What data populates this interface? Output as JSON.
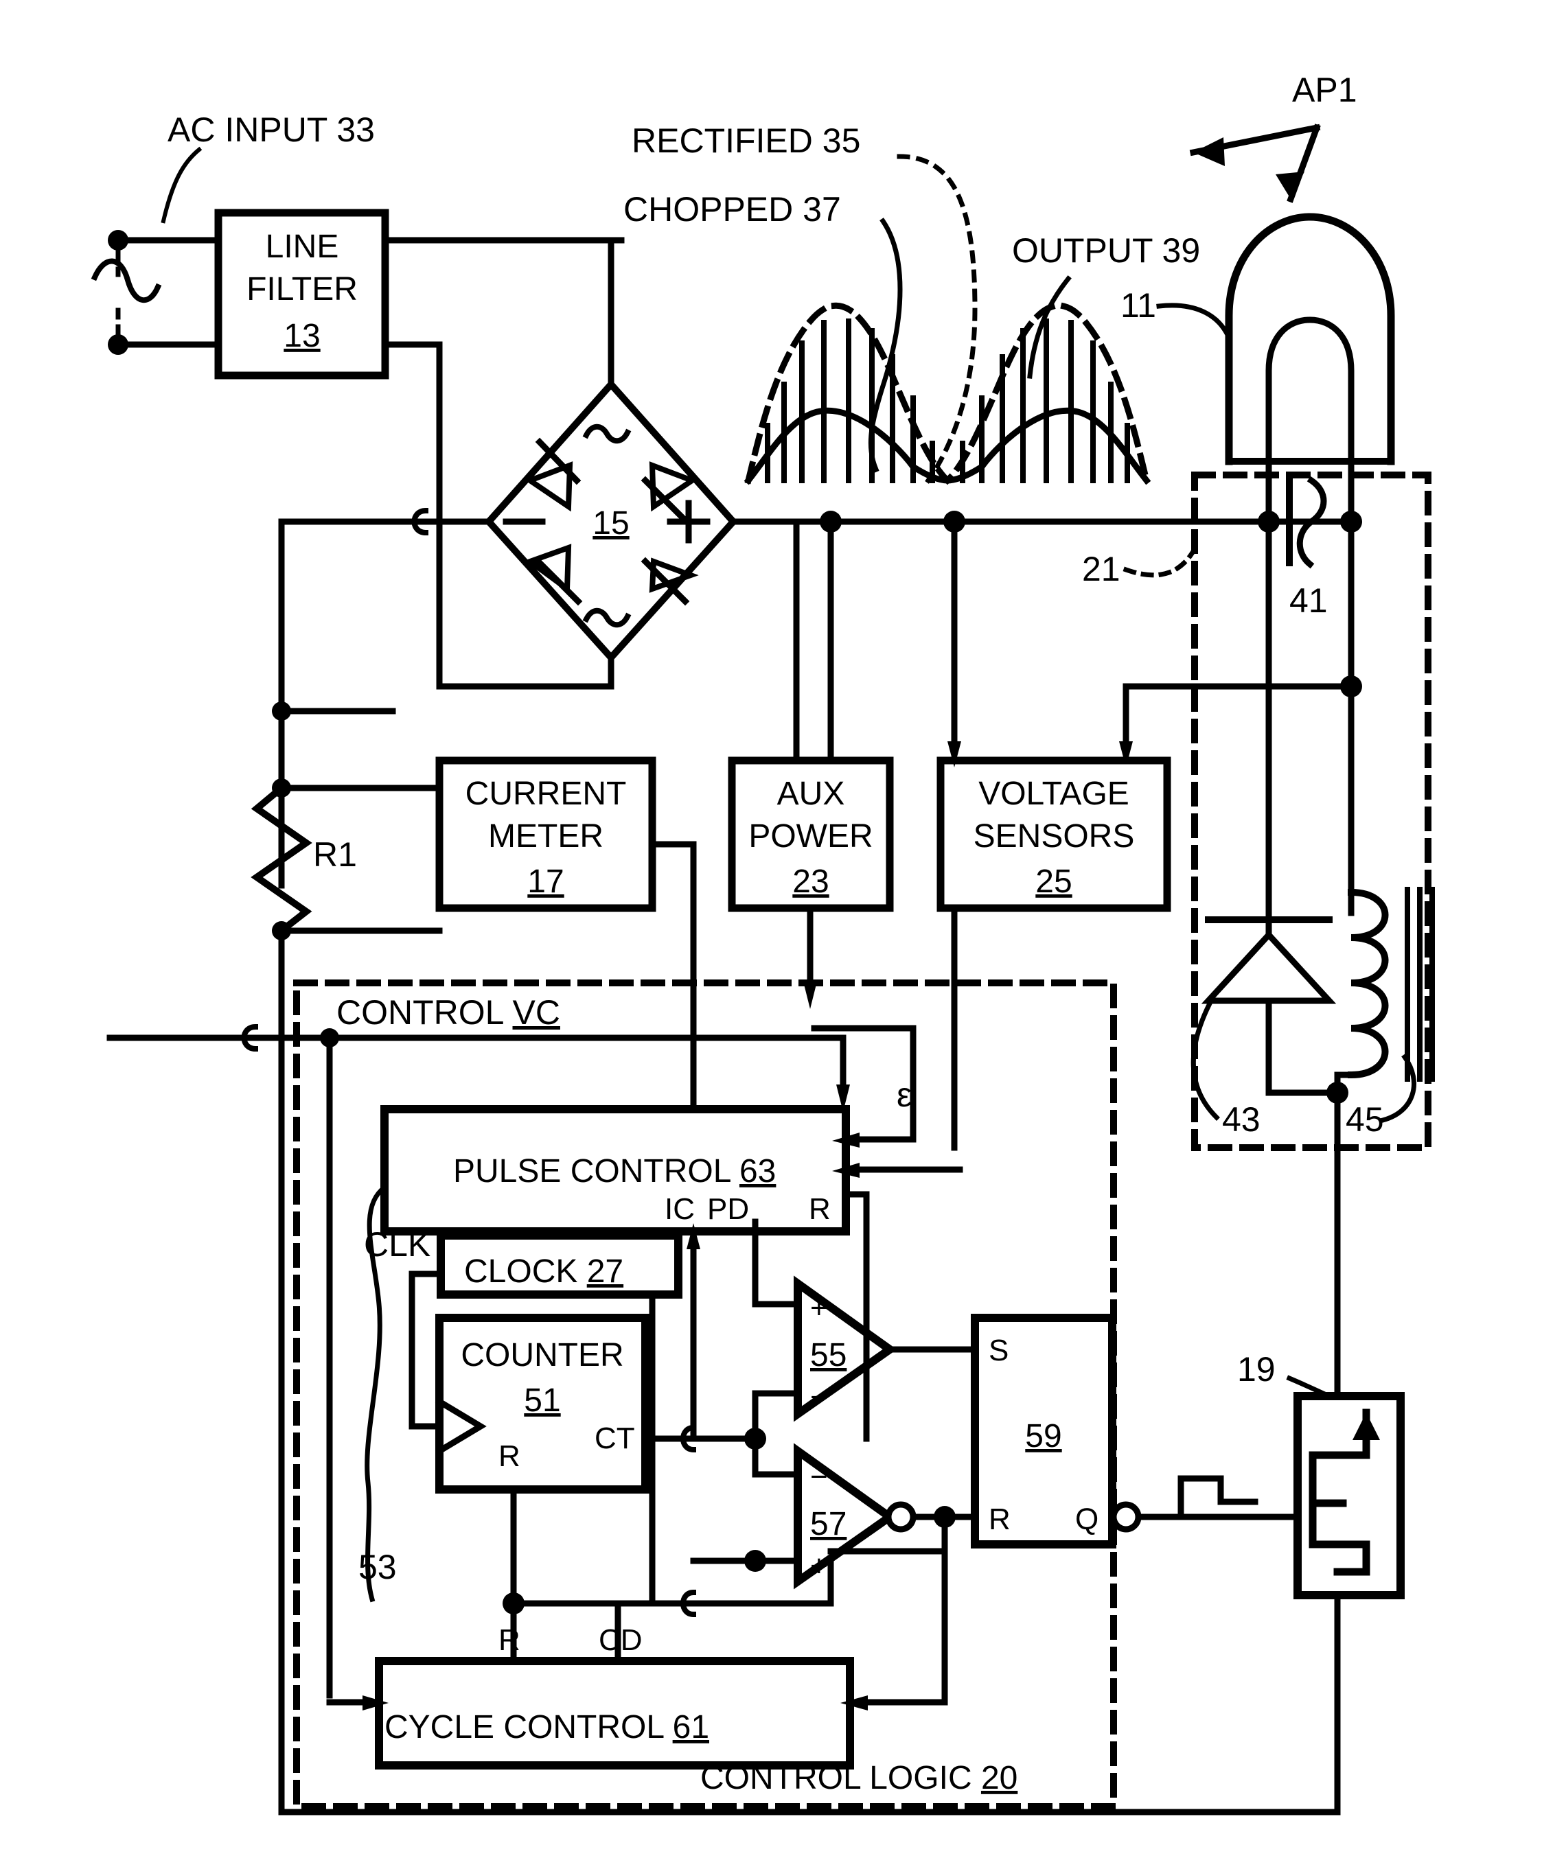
{
  "figure": {
    "type": "patent-circuit-schematic",
    "description": "Ballast circuit for an arc lamp with line filter, bridge rectifier, control logic and switching output stage"
  },
  "callouts": {
    "ac_input": "AC INPUT 33",
    "rectified": "RECTIFIED 35",
    "chopped": "CHOPPED 37",
    "output": "OUTPUT  39",
    "ap1": "AP1",
    "lamp_ref": "11",
    "dashed_box_21": "21",
    "cap_41": "41",
    "diode_43": "43",
    "inductor_45": "45",
    "switch_19": "19",
    "clk_wire_53": "53",
    "clk_label": "CLK",
    "epsilon": "ε",
    "resistor_r1": "R1"
  },
  "blocks": {
    "line_filter": {
      "line1": "LINE",
      "line2": "FILTER",
      "ref": "13"
    },
    "bridge": {
      "ref": "15",
      "neg": "−",
      "pos": "+",
      "ac_top": "∿",
      "ac_bottom": "∿"
    },
    "current_meter": {
      "line1": "CURRENT",
      "line2": "METER",
      "ref": "17"
    },
    "aux_power": {
      "line1": "AUX",
      "line2": "POWER",
      "ref": "23"
    },
    "voltage_sensors": {
      "line1": "VOLTAGE",
      "line2": "SENSORS",
      "ref": "25"
    },
    "pulse_control": {
      "label": "PULSE CONTROL ",
      "ref": "63",
      "pins": [
        "IC",
        "PD",
        "R"
      ]
    },
    "clock": {
      "label": "CLOCK  ",
      "ref": "27"
    },
    "counter": {
      "line1": "COUNTER",
      "ref": "51",
      "pins": [
        "CT",
        "R"
      ]
    },
    "comparator_55": {
      "ref": "55",
      "in_top": "+",
      "in_bottom": "−"
    },
    "comparator_57": {
      "ref": "57",
      "in_top": "−",
      "in_bottom": "+"
    },
    "flipflop_59": {
      "ref": "59",
      "pins": [
        "S",
        "R",
        "Q"
      ]
    },
    "cycle_control": {
      "label": "CYCLE CONTROL ",
      "ref": "61",
      "pins": [
        "R",
        "CD"
      ]
    },
    "control_vc": {
      "label": "CONTROL ",
      "ref": "VC"
    },
    "control_logic": {
      "label": "CONTROL LOGIC ",
      "ref": "20"
    }
  },
  "colors": {
    "ink": "#000000",
    "paper": "#ffffff"
  }
}
